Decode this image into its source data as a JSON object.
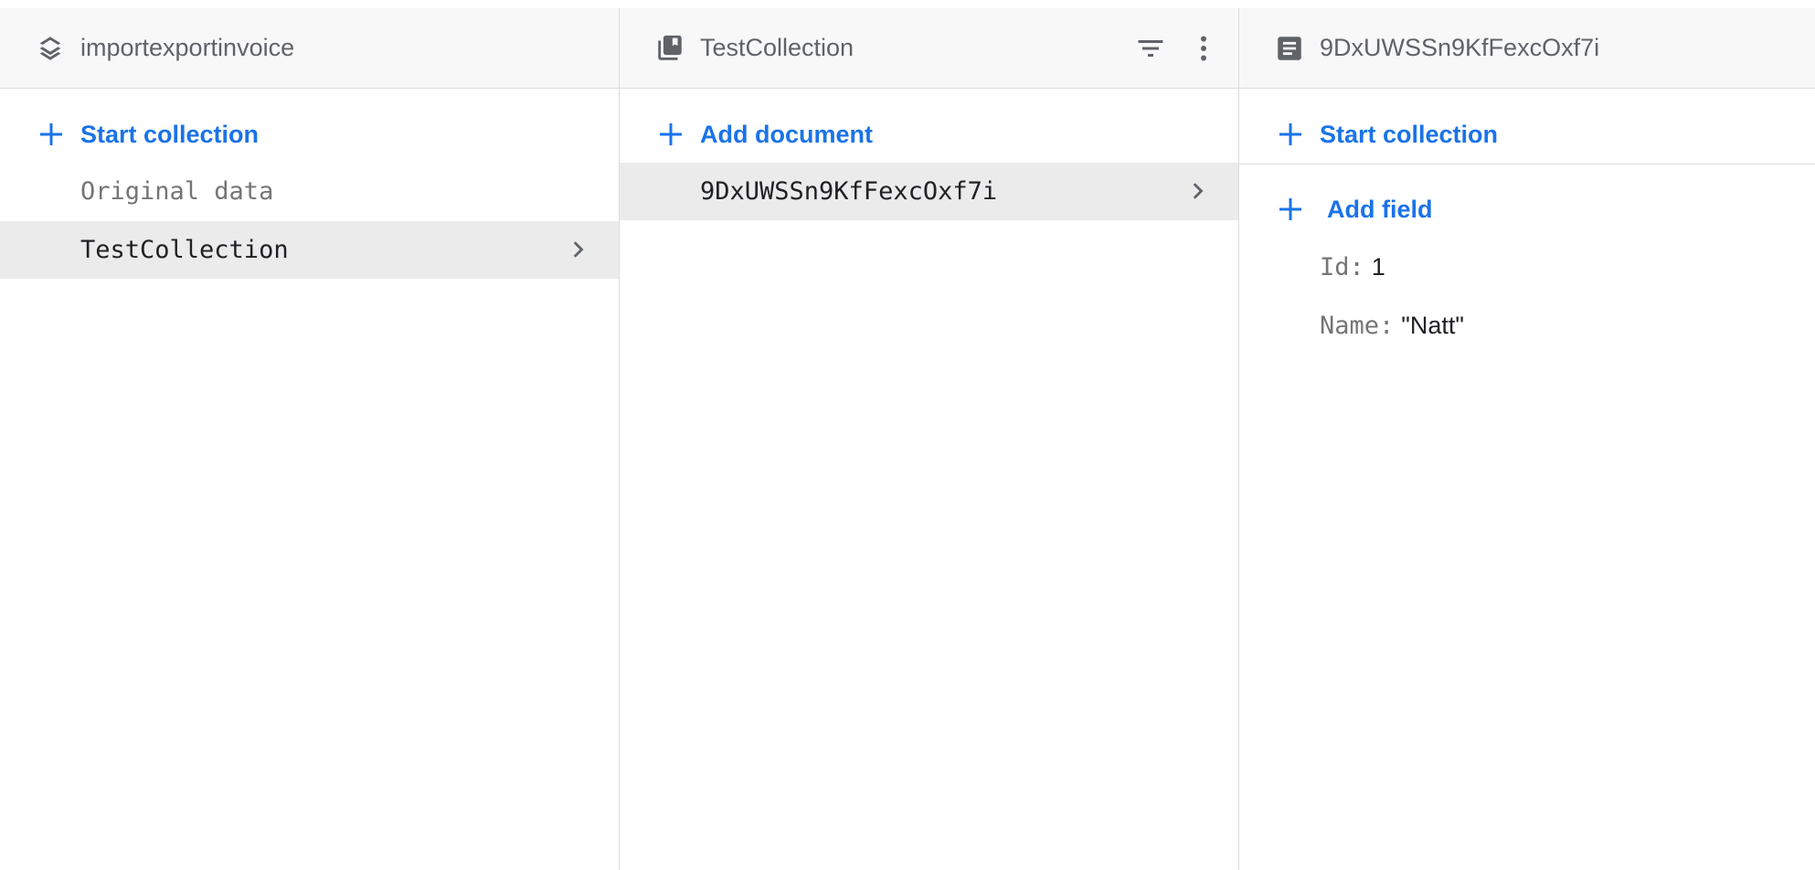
{
  "panels": {
    "root": {
      "title": "importexportinvoice",
      "add_label": "Start collection",
      "collections": [
        {
          "name": "Original data",
          "selected": false
        },
        {
          "name": "TestCollection",
          "selected": true
        }
      ]
    },
    "collection": {
      "title": "TestCollection",
      "add_label": "Add document",
      "documents": [
        {
          "id": "9DxUWSSn9KfFexcOxf7i",
          "selected": true
        }
      ]
    },
    "document": {
      "title": "9DxUWSSn9KfFexcOxf7i",
      "start_collection_label": "Start collection",
      "add_field_label": "Add field",
      "fields": [
        {
          "key": "Id:",
          "value": "1"
        },
        {
          "key": "Name:",
          "value": "\"Natt\""
        }
      ]
    }
  },
  "colors": {
    "accent": "#1a73e8",
    "header_bg": "#f8f8f8",
    "selected_bg": "#ebebeb",
    "icon_gray": "#5f6368"
  },
  "icons": {
    "root": "layers-icon",
    "collection": "collection-icon",
    "document": "document-icon",
    "filter": "filter-icon",
    "menu": "more-vert-icon",
    "add": "plus-icon",
    "chevron": "chevron-right-icon"
  }
}
